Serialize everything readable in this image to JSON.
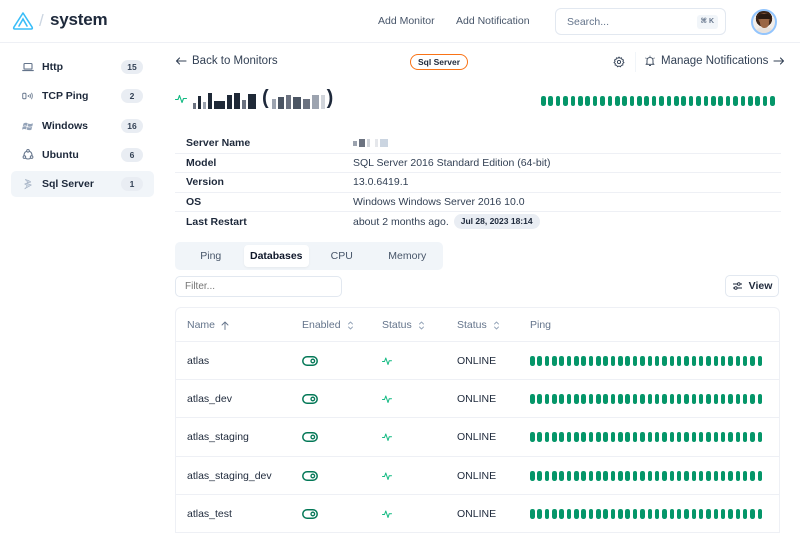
{
  "header": {
    "app_title": "system",
    "separator": "/",
    "nav": [
      {
        "label": "Add Monitor"
      },
      {
        "label": "Add Notification"
      }
    ],
    "search": {
      "placeholder": "Search...",
      "shortcut": "⌘ K"
    },
    "logo_icon": "logo-icon",
    "avatar_icon": "user-avatar"
  },
  "sidebar": {
    "items": [
      {
        "label": "Http",
        "count": "15",
        "icon": "laptop-icon",
        "active": false
      },
      {
        "label": "TCP Ping",
        "count": "2",
        "icon": "signal-icon",
        "active": false
      },
      {
        "label": "Windows",
        "count": "16",
        "icon": "windows-icon",
        "active": false
      },
      {
        "label": "Ubuntu",
        "count": "6",
        "icon": "ubuntu-icon",
        "active": false
      },
      {
        "label": "Sql Server",
        "count": "1",
        "icon": "sql-server-icon",
        "active": true
      }
    ]
  },
  "monitor": {
    "back_label": "Back to Monitors",
    "type_badge": "Sql Server",
    "manage_notifications_label": "Manage Notifications",
    "title_open": "(",
    "title_close": ")",
    "title_redacted": true,
    "status_color": "#059669",
    "ping_history": {
      "count": 32,
      "status": "up"
    }
  },
  "info": [
    {
      "label": "Server Name",
      "value": "",
      "redacted": true
    },
    {
      "label": "Model",
      "value": "SQL Server 2016 Standard Edition (64-bit)"
    },
    {
      "label": "Version",
      "value": "13.0.6419.1"
    },
    {
      "label": "OS",
      "value": "Windows Windows Server 2016 10.0"
    },
    {
      "label": "Last Restart",
      "value": "about 2 months ago.",
      "pill": "Jul 28, 2023 18:14"
    }
  ],
  "tabs": [
    {
      "label": "Ping",
      "active": false
    },
    {
      "label": "Databases",
      "active": true
    },
    {
      "label": "CPU",
      "active": false
    },
    {
      "label": "Memory",
      "active": false
    }
  ],
  "filter": {
    "placeholder": "Filter...",
    "value": ""
  },
  "view_button": {
    "label": "View"
  },
  "table": {
    "columns": [
      {
        "label": "Name",
        "sort": "asc"
      },
      {
        "label": "Enabled",
        "sort": "none"
      },
      {
        "label": "Status",
        "sort": "none"
      },
      {
        "label": "Status",
        "sort": "none"
      },
      {
        "label": "Ping",
        "sort": null
      }
    ],
    "rows": [
      {
        "name": "atlas",
        "enabled": true,
        "status": "ONLINE",
        "ping_count": 32
      },
      {
        "name": "atlas_dev",
        "enabled": true,
        "status": "ONLINE",
        "ping_count": 32
      },
      {
        "name": "atlas_staging",
        "enabled": true,
        "status": "ONLINE",
        "ping_count": 32
      },
      {
        "name": "atlas_staging_dev",
        "enabled": true,
        "status": "ONLINE",
        "ping_count": 32
      },
      {
        "name": "atlas_test",
        "enabled": true,
        "status": "ONLINE",
        "ping_count": 32
      }
    ]
  }
}
